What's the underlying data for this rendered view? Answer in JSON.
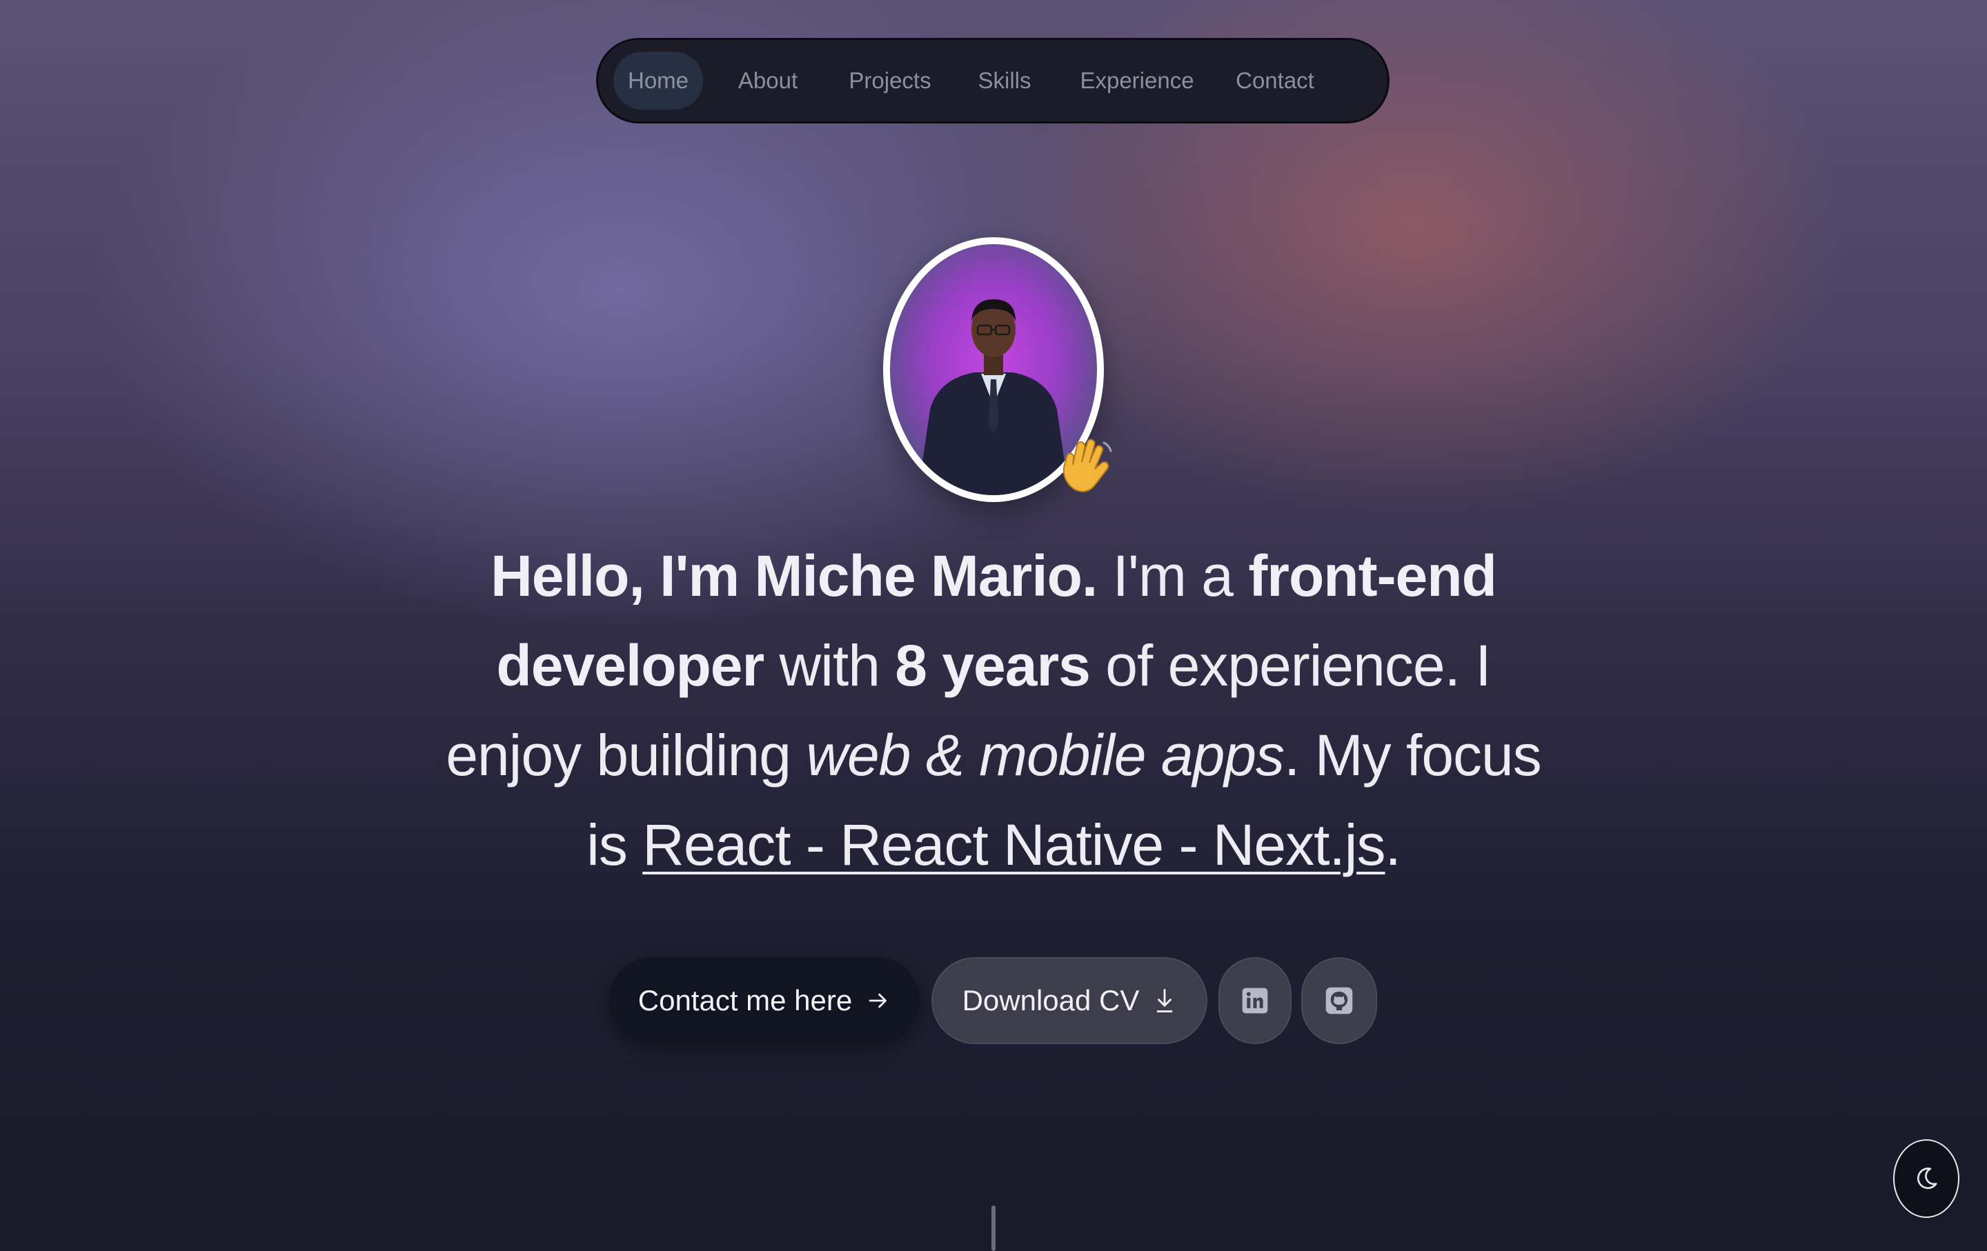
{
  "nav": {
    "items": [
      {
        "label": "Home",
        "active": true
      },
      {
        "label": "About"
      },
      {
        "label": "Projects"
      },
      {
        "label": "Skills"
      },
      {
        "label": "Experience"
      },
      {
        "label": "Contact"
      }
    ]
  },
  "hero": {
    "avatar_icon": "profile-photo",
    "wave_icon": "waving-hand-emoji",
    "intro": {
      "hello": "Hello, I'm Miche Mario.",
      "im_a": " I'm a ",
      "role": "front-end developer",
      "with": " with ",
      "years": "8 years",
      "experience": " of experience. I enjoy building ",
      "apps": "web & mobile apps",
      "focus": ". My focus is ",
      "stack": "React - React Native - Next.js",
      "end": "."
    }
  },
  "actions": {
    "contact_label": "Contact me here",
    "contact_icon": "arrow-right-icon",
    "cv_label": "Download CV",
    "cv_icon": "download-icon",
    "linkedin_icon": "linkedin-icon",
    "github_icon": "github-icon"
  },
  "theme_toggle": {
    "icon": "moon-icon"
  },
  "colors": {
    "accent_dark": "#111522",
    "nav_bg": "#1c1b28",
    "button_gray": "#3e3d4c"
  }
}
